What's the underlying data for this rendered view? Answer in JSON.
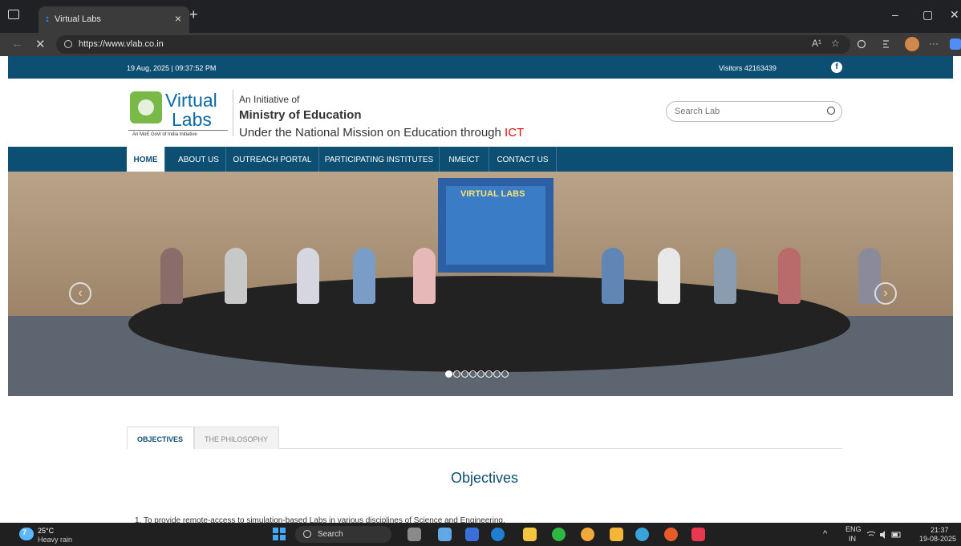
{
  "browser": {
    "tab_title": "Virtual Labs",
    "tab_close": "×",
    "new_tab": "+",
    "url": "https://www.vlab.co.in",
    "minimize": "–",
    "maximize": "▢",
    "close": "✕",
    "back": "←",
    "stop": "✕",
    "reader": "A¹",
    "fav": "☆",
    "more": "···"
  },
  "site": {
    "datetime": "19 Aug, 2025 | 09:37:52 PM",
    "visitors": "Visitors  42163439",
    "facebook_glyph": "f",
    "logo_top": "Virtual",
    "logo_bottom": "Labs",
    "logo_tagline": "An MoE Govt of India Initiative",
    "initiative_line1": "An Initiative of",
    "initiative_line2": "Ministry of Education",
    "initiative_line3_prefix": "Under the National Mission on Education through ",
    "initiative_line3_ict": "ICT",
    "search_placeholder": "Search Lab",
    "menu": [
      "HOME",
      "ABOUT US",
      "OUTREACH PORTAL",
      "PARTICIPATING INSTITUTES",
      "NMEICT",
      "CONTACT US"
    ],
    "carousel_screen_text": "VIRTUAL LABS",
    "carousel_prev": "‹",
    "carousel_next": "›",
    "carousel_slides": 8,
    "carousel_active": 1,
    "tabs": [
      "OBJECTIVES",
      "THE PHILOSOPHY"
    ],
    "objectives_title": "Objectives",
    "objectives_first": "1. To provide remote-access to simulation-based Labs in various disciplines of Science and Engineering."
  },
  "taskbar": {
    "temp": "25°C",
    "weather": "Heavy rain",
    "search_label": "Search",
    "lang1": "ENG",
    "lang2": "IN",
    "time": "21:37",
    "date": "19-08-2025",
    "tray_up": "^",
    "weather_badge": "7"
  }
}
